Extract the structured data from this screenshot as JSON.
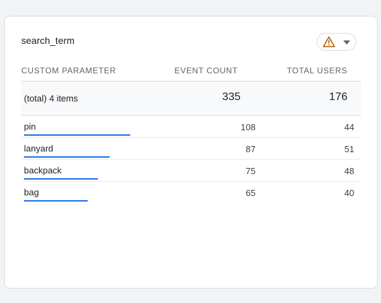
{
  "card": {
    "title": "search_term",
    "warning_icon": "warning-triangle-icon",
    "dropdown_icon": "caret-down-icon",
    "accent_color": "#1a73e8",
    "warning_color": "#b06000"
  },
  "table": {
    "headers": {
      "param": "CUSTOM PARAMETER",
      "events": "EVENT COUNT",
      "users": "TOTAL USERS"
    },
    "total": {
      "label": "(total) 4 items",
      "events": "335",
      "users": "176"
    },
    "rows": [
      {
        "label": "pin",
        "events": "108",
        "users": "44",
        "share": 1.0
      },
      {
        "label": "lanyard",
        "events": "87",
        "users": "51",
        "share": 0.806
      },
      {
        "label": "backpack",
        "events": "75",
        "users": "48",
        "share": 0.694
      },
      {
        "label": "bag",
        "events": "65",
        "users": "40",
        "share": 0.602
      }
    ]
  }
}
